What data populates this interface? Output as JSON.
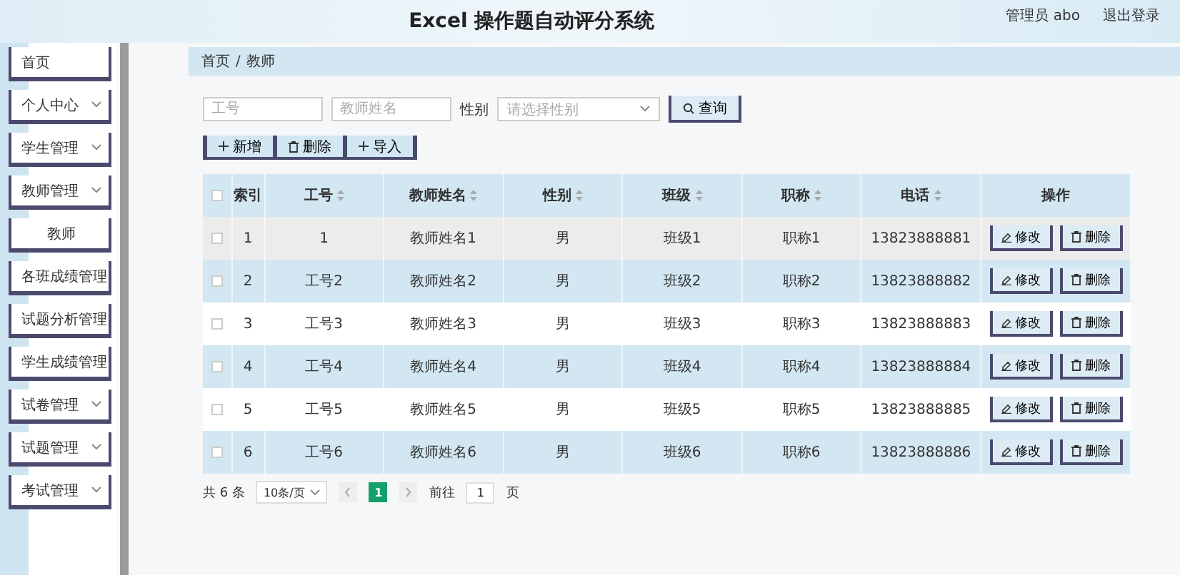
{
  "header": {
    "title": "Excel 操作题自动评分系统",
    "user": "管理员 abo",
    "logout": "退出登录"
  },
  "sidebar": {
    "items": [
      {
        "label": "首页",
        "kind": "link"
      },
      {
        "label": "个人中心",
        "kind": "menu"
      },
      {
        "label": "学生管理",
        "kind": "menu"
      },
      {
        "label": "教师管理",
        "kind": "menu",
        "children": [
          {
            "label": "教师"
          }
        ]
      },
      {
        "label": "各班成绩管理",
        "kind": "menu"
      },
      {
        "label": "试题分析管理",
        "kind": "menu"
      },
      {
        "label": "学生成绩管理",
        "kind": "menu"
      },
      {
        "label": "试卷管理",
        "kind": "menu"
      },
      {
        "label": "试题管理",
        "kind": "menu"
      },
      {
        "label": "考试管理",
        "kind": "menu"
      }
    ]
  },
  "breadcrumb": {
    "items": [
      "首页",
      "教师"
    ],
    "separator": "/"
  },
  "search": {
    "fields": [
      {
        "placeholder": "工号"
      },
      {
        "placeholder": "教师姓名"
      }
    ],
    "gender_label": "性别",
    "gender_select": {
      "placeholder": "请选择性别"
    },
    "button": "查询"
  },
  "actions": [
    {
      "label": "新增",
      "kind": "add"
    },
    {
      "label": "删除",
      "kind": "delete"
    },
    {
      "label": "导入",
      "kind": "add"
    }
  ],
  "table": {
    "select_all_checked": false,
    "columns": [
      {
        "label": "索引",
        "sortable": false
      },
      {
        "label": "工号",
        "sortable": true
      },
      {
        "label": "教师姓名",
        "sortable": true
      },
      {
        "label": "性别",
        "sortable": true
      },
      {
        "label": "班级",
        "sortable": true
      },
      {
        "label": "职称",
        "sortable": true
      },
      {
        "label": "电话",
        "sortable": true
      },
      {
        "label": "操作",
        "sortable": false
      }
    ],
    "rows": [
      {
        "cells": [
          "1",
          "1",
          "教师姓名1",
          "男",
          "班级1",
          "职称1",
          "13823888881"
        ],
        "buttons": [
          "修改",
          "删除"
        ],
        "highlighted": true,
        "checked": false
      },
      {
        "cells": [
          "2",
          "工号2",
          "教师姓名2",
          "男",
          "班级2",
          "职称2",
          "13823888882"
        ],
        "buttons": [
          "修改",
          "删除"
        ],
        "highlighted": false,
        "checked": false
      },
      {
        "cells": [
          "3",
          "工号3",
          "教师姓名3",
          "男",
          "班级3",
          "职称3",
          "13823888883"
        ],
        "buttons": [
          "修改",
          "删除"
        ],
        "highlighted": false,
        "checked": false
      },
      {
        "cells": [
          "4",
          "工号4",
          "教师姓名4",
          "男",
          "班级4",
          "职称4",
          "13823888884"
        ],
        "buttons": [
          "修改",
          "删除"
        ],
        "highlighted": false,
        "checked": false
      },
      {
        "cells": [
          "5",
          "工号5",
          "教师姓名5",
          "男",
          "班级5",
          "职称5",
          "13823888885"
        ],
        "buttons": [
          "修改",
          "删除"
        ],
        "highlighted": false,
        "checked": false
      },
      {
        "cells": [
          "6",
          "工号6",
          "教师姓名6",
          "男",
          "班级6",
          "职称6",
          "13823888886"
        ],
        "buttons": [
          "修改",
          "删除"
        ],
        "highlighted": false,
        "checked": false
      }
    ]
  },
  "pagination": {
    "total": "共 6 条",
    "page_size": "10条/页",
    "pages": [
      {
        "label": "1",
        "selected": true
      }
    ],
    "goto_label": "前往",
    "goto_value": "1",
    "page_unit": "页"
  }
}
